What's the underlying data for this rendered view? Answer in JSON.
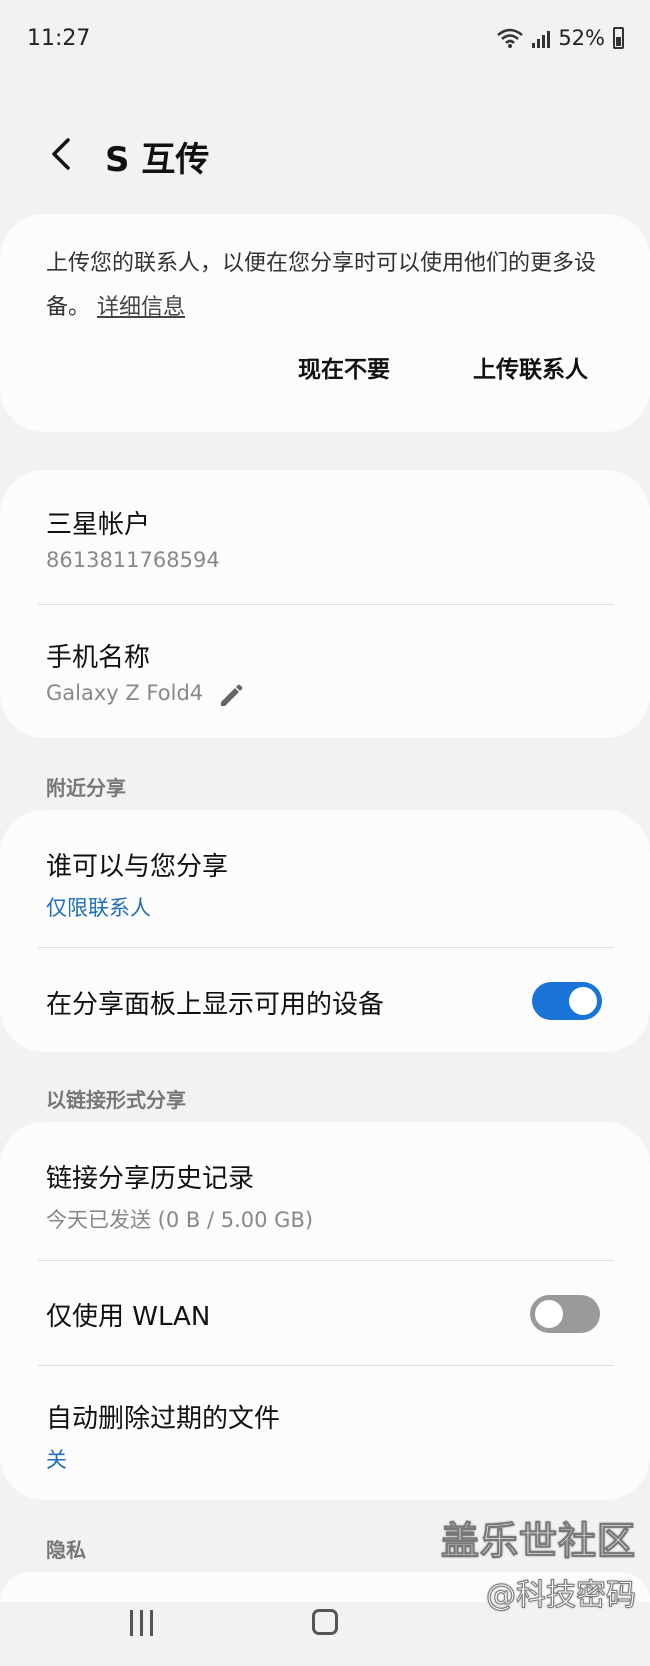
{
  "status": {
    "time": "11:27",
    "battery": "52%"
  },
  "header": {
    "title": "S 互传"
  },
  "promo": {
    "text": "上传您的联系人，以便在您分享时可以使用他们的更多设备。",
    "link": "详细信息",
    "buttons": {
      "not_now": "现在不要",
      "upload": "上传联系人"
    }
  },
  "account": {
    "samsung_account_title": "三星帐户",
    "samsung_account_value": "8613811768594",
    "phone_name_title": "手机名称",
    "phone_name_value": "Galaxy Z Fold4"
  },
  "nearby": {
    "section": "附近分享",
    "who_can_share_title": "谁可以与您分享",
    "who_can_share_value": "仅限联系人",
    "show_devices_title": "在分享面板上显示可用的设备",
    "show_devices_on": true
  },
  "link_share": {
    "section": "以链接形式分享",
    "history_title": "链接分享历史记录",
    "history_value": "今天已发送 (0 B / 5.00 GB)",
    "wlan_only_title": "仅使用 WLAN",
    "wlan_only_on": false,
    "auto_delete_title": "自动删除过期的文件",
    "auto_delete_value": "关"
  },
  "privacy": {
    "section": "隐私"
  },
  "watermark": {
    "line1": "盖乐世社区",
    "line2": "@科技密码"
  },
  "icons": [
    "wifi-icon",
    "signal-icon",
    "battery-icon",
    "back-arrow-icon",
    "pencil-icon",
    "recent-apps-icon",
    "home-icon"
  ],
  "colors": {
    "background": "#f2f2f2",
    "card": "#fcfcfc",
    "accent": "#1a73d6",
    "link_blue": "#1e6fb8"
  }
}
